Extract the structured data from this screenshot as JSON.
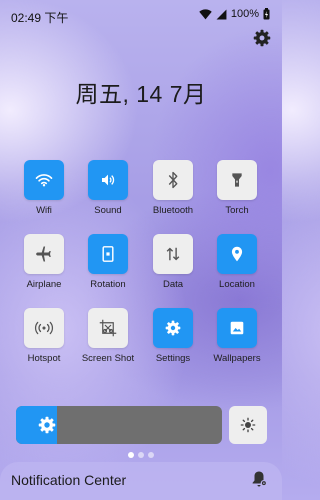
{
  "status_bar": {
    "time": "02:49 下午",
    "battery_percent": "100%",
    "icons": [
      "wifi-icon",
      "signal-icon",
      "battery-icon"
    ]
  },
  "settings_icon": "gear-icon",
  "date_text": "周五, 14 7月",
  "tiles": [
    {
      "label": "Wifi",
      "icon": "wifi-icon",
      "on": true
    },
    {
      "label": "Sound",
      "icon": "volume-icon",
      "on": true
    },
    {
      "label": "Bluetooth",
      "icon": "bluetooth-icon",
      "on": false
    },
    {
      "label": "Torch",
      "icon": "flashlight-icon",
      "on": false
    },
    {
      "label": "Airplane",
      "icon": "airplane-icon",
      "on": false
    },
    {
      "label": "Rotation",
      "icon": "rotation-icon",
      "on": true
    },
    {
      "label": "Data",
      "icon": "data-arrows-icon",
      "on": false
    },
    {
      "label": "Location",
      "icon": "location-pin-icon",
      "on": true
    },
    {
      "label": "Hotspot",
      "icon": "hotspot-icon",
      "on": false
    },
    {
      "label": "Screen Shot",
      "icon": "screenshot-icon",
      "on": false
    },
    {
      "label": "Settings",
      "icon": "gear-icon",
      "on": true
    },
    {
      "label": "Wallpapers",
      "icon": "wallpaper-icon",
      "on": true
    }
  ],
  "brightness": {
    "level": 0.2,
    "icon": "brightness-icon",
    "auto_icon": "auto-brightness-icon"
  },
  "page_dots": {
    "count": 3,
    "active": 0
  },
  "notification_center": {
    "label": "Notification Center",
    "icon": "notification-settings-icon"
  },
  "colors": {
    "accent": "#2196f3",
    "tile_off": "#eeeeee",
    "slider_track": "#6f6f6f"
  }
}
